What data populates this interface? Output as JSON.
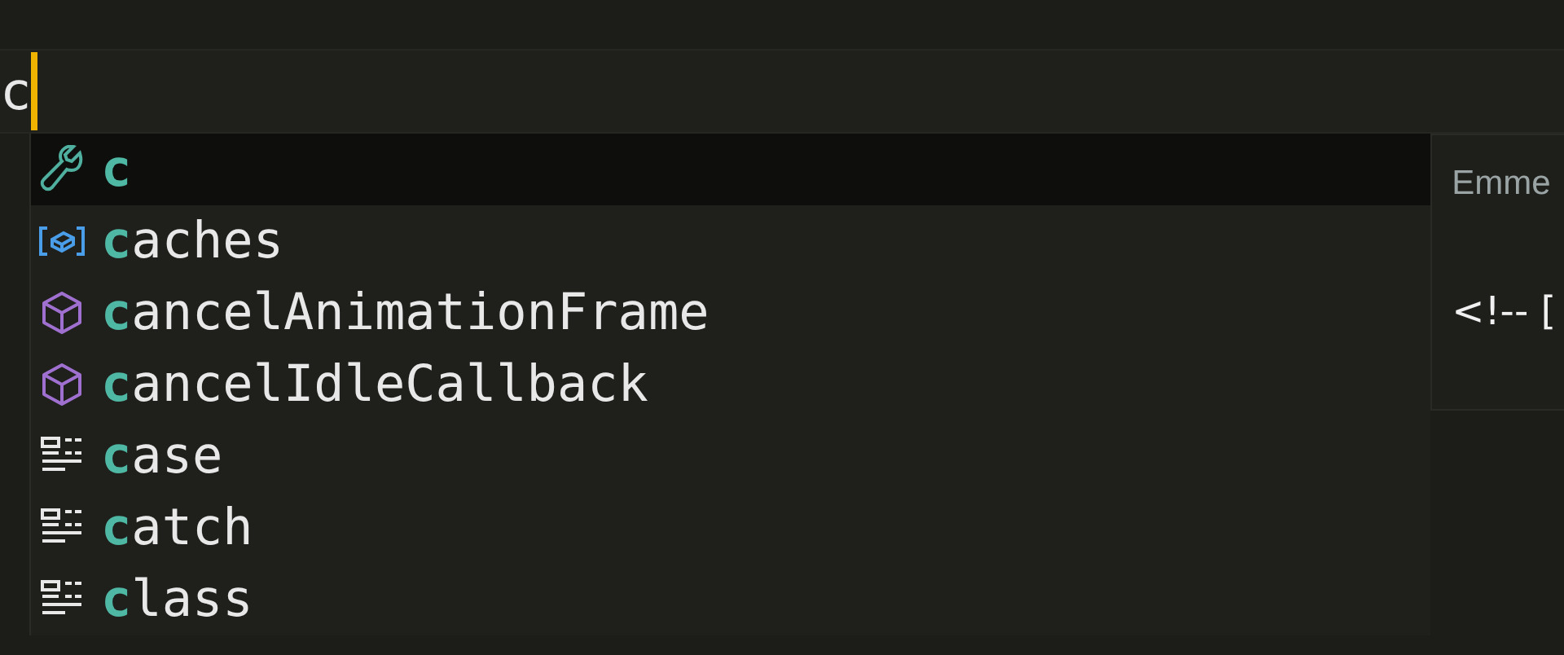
{
  "editor": {
    "typed": "c"
  },
  "suggestions": [
    {
      "kind": "snippet",
      "label": "**c**",
      "selected": true
    },
    {
      "kind": "variable",
      "label": "**c**aches",
      "selected": false
    },
    {
      "kind": "method",
      "label": "**c**ancelAnimationFrame",
      "selected": false
    },
    {
      "kind": "method",
      "label": "**c**ancelIdleCallback",
      "selected": false
    },
    {
      "kind": "keyword",
      "label": "**c**ase",
      "selected": false
    },
    {
      "kind": "keyword",
      "label": "**c**atch",
      "selected": false
    },
    {
      "kind": "keyword",
      "label": "**c**lass",
      "selected": false
    }
  ],
  "details": {
    "title": "Emme",
    "body": "<!-- ["
  }
}
